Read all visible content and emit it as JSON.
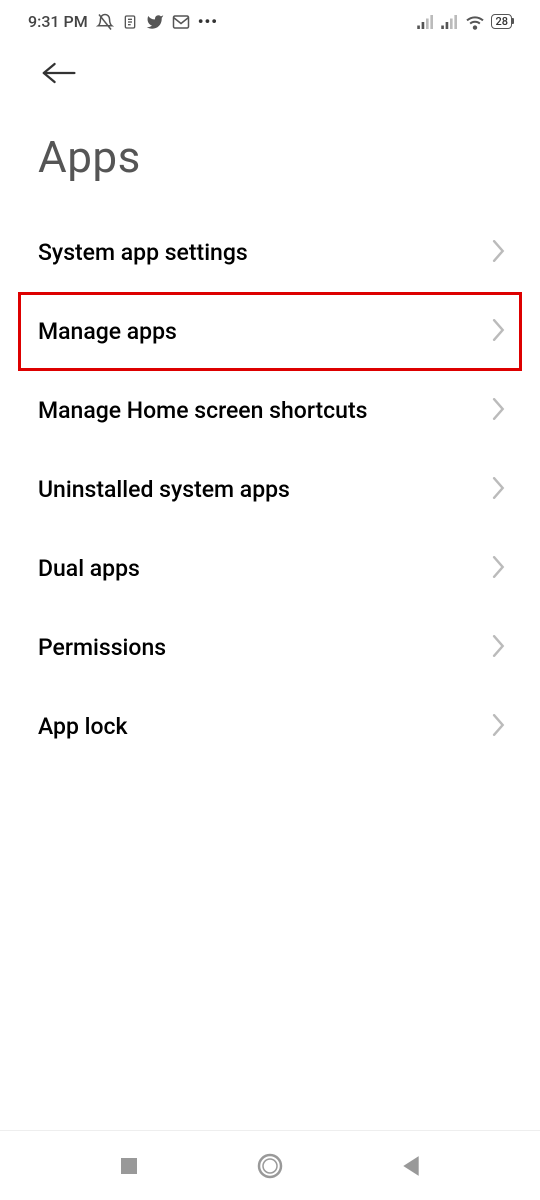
{
  "status": {
    "time": "9:31 PM",
    "battery": "28"
  },
  "page": {
    "title": "Apps"
  },
  "menu": {
    "items": [
      {
        "label": "System app settings"
      },
      {
        "label": "Manage apps"
      },
      {
        "label": "Manage Home screen shortcuts"
      },
      {
        "label": "Uninstalled system apps"
      },
      {
        "label": "Dual apps"
      },
      {
        "label": "Permissions"
      },
      {
        "label": "App lock"
      }
    ],
    "highlighted_index": 1
  }
}
